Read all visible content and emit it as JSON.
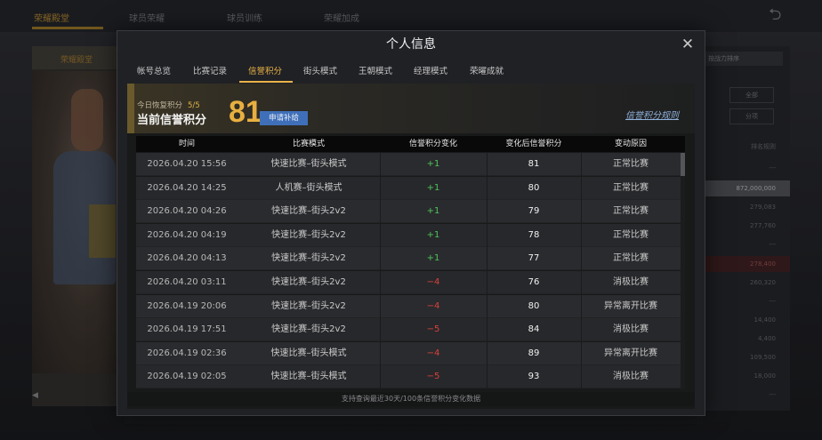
{
  "background": {
    "tabs": [
      "荣耀殿堂",
      "球员荣耀",
      "球员训练",
      "荣耀加成"
    ],
    "left_panel_label": "荣耀殿堂",
    "right_select": "按战力排序",
    "right_buttons": [
      "全部",
      "分项"
    ],
    "right_values": [
      "排名规则",
      "---",
      "872,000,000",
      "279,083",
      "277,760",
      "---",
      "278,400",
      "260,320",
      "---",
      "14,400",
      "4,400",
      "109,500",
      "18,000",
      "---"
    ]
  },
  "modal": {
    "title": "个人信息",
    "tabs": [
      "帐号总览",
      "比赛记录",
      "信誉积分",
      "街头模式",
      "王朝模式",
      "经理模式",
      "荣曜成就"
    ],
    "active_tab": 2
  },
  "credit": {
    "recover_label": "今日恢复积分",
    "recover_value": "5/5",
    "current_label": "当前信誉积分",
    "score": "81",
    "apply_button": "申请补给",
    "rules_link": "信誉积分规则"
  },
  "table": {
    "headers": [
      "时间",
      "比赛模式",
      "信誉积分变化",
      "变化后信誉积分",
      "变动原因"
    ],
    "rows": [
      {
        "time": "2026.04.20  15:56",
        "mode": "快速比赛–街头模式",
        "change": "+1",
        "after": "81",
        "reason": "正常比赛"
      },
      {
        "time": "2026.04.20  14:25",
        "mode": "人机赛–街头模式",
        "change": "+1",
        "after": "80",
        "reason": "正常比赛"
      },
      {
        "time": "2026.04.20  04:26",
        "mode": "快速比赛–街头2v2",
        "change": "+1",
        "after": "79",
        "reason": "正常比赛"
      },
      {
        "time": "2026.04.20  04:19",
        "mode": "快速比赛–街头2v2",
        "change": "+1",
        "after": "78",
        "reason": "正常比赛"
      },
      {
        "time": "2026.04.20  04:13",
        "mode": "快速比赛–街头2v2",
        "change": "+1",
        "after": "77",
        "reason": "正常比赛"
      },
      {
        "time": "2026.04.20  03:11",
        "mode": "快速比赛–街头2v2",
        "change": "−4",
        "after": "76",
        "reason": "消极比赛"
      },
      {
        "time": "2026.04.19  20:06",
        "mode": "快速比赛–街头2v2",
        "change": "−4",
        "after": "80",
        "reason": "异常离开比赛"
      },
      {
        "time": "2026.04.19  17:51",
        "mode": "快速比赛–街头2v2",
        "change": "−5",
        "after": "84",
        "reason": "消极比赛"
      },
      {
        "time": "2026.04.19  02:36",
        "mode": "快速比赛–街头模式",
        "change": "−4",
        "after": "89",
        "reason": "异常离开比赛"
      },
      {
        "time": "2026.04.19  02:05",
        "mode": "快速比赛–街头模式",
        "change": "−5",
        "after": "93",
        "reason": "消极比赛"
      }
    ],
    "footer_note": "支持查询最近30天/100条信誉积分变化数据"
  },
  "colors": {
    "accent_gold": "#e9b347",
    "positive": "#4dc35a",
    "negative": "#d8403c",
    "apply_button": "#3f6fb8",
    "link_blue": "#8fb1dd"
  },
  "icons": {
    "close": "close-icon",
    "back": "back-arrow-icon"
  }
}
